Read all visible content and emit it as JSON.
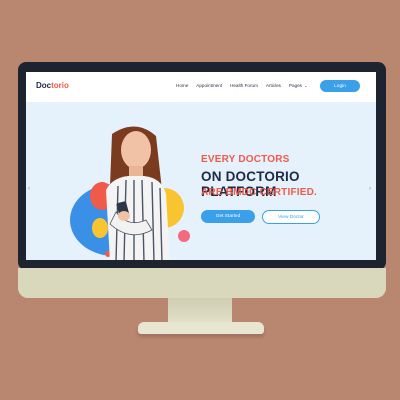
{
  "logo": {
    "part1": "Doc",
    "part2": "torio"
  },
  "nav": {
    "items": [
      "Home",
      "Appointment",
      "Health Forum",
      "Articles",
      "Pages"
    ],
    "login_label": "Login"
  },
  "hero": {
    "line1": "EVERY DOCTORS",
    "line2": "ON DOCTORIO PLATFORM",
    "line3": "ARE BMDC CERTIFIED.",
    "primary_button": "Get Started",
    "secondary_button": "View Doctor"
  },
  "icons": {
    "left_arrow": "chevron-left-icon",
    "right_arrow": "chevron-right-icon",
    "pages_dropdown": "chevron-down-icon"
  },
  "colors": {
    "brand": "#f05a4a",
    "accent": "#3aa0ea",
    "dark": "#1f2a44",
    "background": "#b98670",
    "screen_bg": "#e6f2fb"
  }
}
